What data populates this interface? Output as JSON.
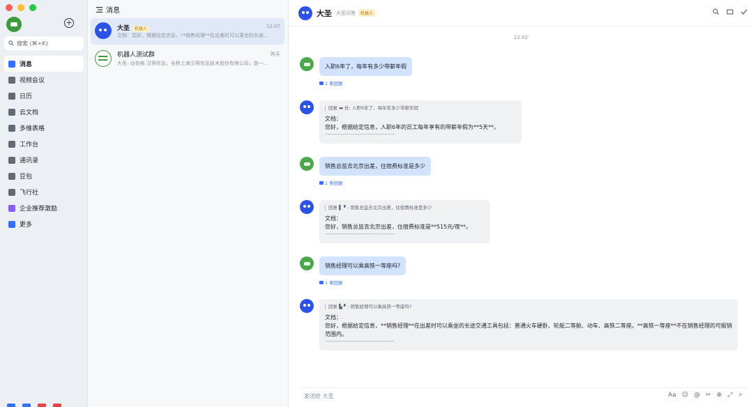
{
  "sidebar": {
    "add_symbol": "+",
    "search_placeholder": "搜索 (⌘+K)",
    "items": [
      {
        "label": "消息",
        "icon": "message-icon",
        "color": "#3370ff"
      },
      {
        "label": "视频会议",
        "icon": "video-icon",
        "color": "#646a73"
      },
      {
        "label": "日历",
        "icon": "calendar-icon",
        "color": "#646a73"
      },
      {
        "label": "云文档",
        "icon": "docs-icon",
        "color": "#646a73"
      },
      {
        "label": "多维表格",
        "icon": "table-icon",
        "color": "#646a73"
      },
      {
        "label": "工作台",
        "icon": "workspace-icon",
        "color": "#646a73"
      },
      {
        "label": "通讯录",
        "icon": "contacts-icon",
        "color": "#646a73"
      },
      {
        "label": "豆包",
        "icon": "doubao-icon",
        "color": "#646a73"
      },
      {
        "label": "飞行社",
        "icon": "community-icon",
        "color": "#646a73"
      },
      {
        "label": "企业推荐激励",
        "icon": "referral-icon",
        "color": "#8b5cf6"
      },
      {
        "label": "更多",
        "icon": "more-icon",
        "color": "#3370ff"
      }
    ]
  },
  "conversations": {
    "title": "消息",
    "items": [
      {
        "name": "大圣",
        "badge": "机器人",
        "time": "12:07",
        "preview": "文档：您好，根据给定信息，**销售经理**在出差时可以乘坐的长途..."
      },
      {
        "name": "机器人测试群",
        "badge": "",
        "time": "昨天",
        "preview": "大圣: @伯格 汉得信息，全称上海汉得信息技术股份有限公司，是一..."
      }
    ]
  },
  "chat": {
    "name": "大圣",
    "subtitle": "大圣问答",
    "badge": "机器人",
    "time_separator": "12:02",
    "messages": [
      {
        "user_text": "入职6年了，每年有多少带薪年假",
        "replies": "1 条回复",
        "bot_quote": "回复 ▬  杜: 入职6年了，每年有多少带薪年假",
        "bot_label": "文档：",
        "bot_text": "您好，根据给定信息，入职6年的员工每年享有的带薪年假为**5天**。",
        "bot_dash": "-------------------------------------------------"
      },
      {
        "user_text": "销售总监去北京出差，住宿费标准是多少",
        "replies": "1 条回复",
        "bot_quote": "回复 ▌ ▘: 销售总监去北京出差，住宿费标准是多少",
        "bot_label": "文档：",
        "bot_text": "您好，销售总监去北京出差，住宿费标准是**515元/夜**。",
        "bot_dash": "-------------------------------------------------"
      },
      {
        "user_text": "销售经理可以乘高铁一等座吗?",
        "replies": "1 条回复",
        "bot_quote": "回复 ▙ ▘: 销售经理可以乘高铁一等座吗?",
        "bot_label": "文档：",
        "bot_text": "您好，根据给定信息，**销售经理**在出差时可以乘坐的长途交通工具包括：普通火车硬卧、轮船二等舱、动车、高铁二等座。**高铁一等座**不在销售经理的可报销范围内。",
        "bot_dash": "-------------------------------------------------"
      }
    ],
    "input_placeholder": "发送给 大圣"
  },
  "colors": {
    "accent": "#3370ff",
    "user_bubble": "#d1e3ff",
    "bot_bubble": "#f0f1f3",
    "bot_avatar": "#2c53e8"
  }
}
